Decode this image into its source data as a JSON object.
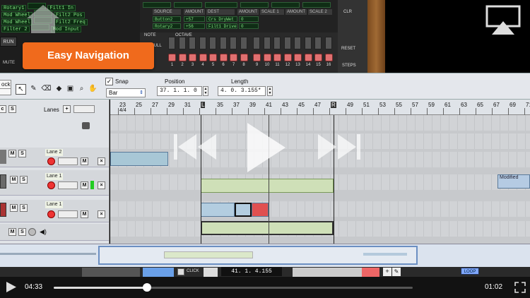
{
  "rack": {
    "lcd_rows": [
      [
        "Rotary1",
        "",
        "Filt1 In"
      ],
      [
        "Mod Wheel",
        "",
        "Filt2 Pos"
      ],
      [
        "Mod Wheel",
        "",
        "Filt2 Freq"
      ],
      [
        "Filter 2",
        "",
        "Mod Input"
      ]
    ],
    "matrix_headers": [
      "SOURCE",
      "AMOUNT",
      "DEST",
      "AMOUNT",
      "SCALE 1",
      "AMOUNT",
      "SCALE 2"
    ],
    "matrix_values": {
      "col_source": [
        "Button2",
        "Rotary2"
      ],
      "col_amount": [
        "",
        "+57",
        "+56"
      ],
      "col_dest": [
        "",
        "Crs DryWet",
        "Filt1 Drive"
      ],
      "col_amount2": [
        "0",
        "0",
        "0"
      ]
    },
    "run_label": "RUN",
    "mute_label": "MUTE",
    "full_label": "FULL",
    "clr_label": "CLR",
    "reset_label": "RESET",
    "steps_label": "STEPS",
    "note_label": "NOTE",
    "octave_label": "OCTAVE",
    "step_numbers": [
      "1",
      "2",
      "3",
      "4",
      "5",
      "6",
      "7",
      "8",
      "9",
      "10",
      "11",
      "12",
      "13",
      "14",
      "15",
      "16"
    ],
    "brand_color": "#f06a1c",
    "lcd_color": "#7fe07f"
  },
  "banner": {
    "label": "Easy Navigation"
  },
  "toolbar": {
    "block_label": "ock",
    "snap_label": "Snap",
    "snap_checked": true,
    "snap_value": "Bar",
    "position_label": "Position",
    "position_value": "37.  1.  1.     0",
    "length_label": "Length",
    "length_value": "4.  0.  3.155*",
    "tools": [
      "arrow-tool",
      "pencil-tool",
      "eraser-tool",
      "line-tool",
      "razor-tool",
      "magnify-tool",
      "hand-tool"
    ]
  },
  "lanes_header": {
    "label": "Lanes"
  },
  "tracks": [
    {
      "lane_label": "Lane 2",
      "mute": "M",
      "solo": "S"
    },
    {
      "lane_label": "Lane 1",
      "mute": "M",
      "solo": "S"
    },
    {
      "lane_label": "Lane 1",
      "mute": "M",
      "solo": "S"
    },
    {
      "lane_label": "",
      "mute": "M",
      "solo": "S"
    }
  ],
  "ruler": {
    "time_signature": "4/4",
    "bars": [
      "23",
      "25",
      "27",
      "29",
      "31",
      "L",
      "35",
      "37",
      "39",
      "41",
      "43",
      "45",
      "47",
      "R",
      "49",
      "51",
      "53",
      "55",
      "57",
      "59",
      "61",
      "63",
      "65",
      "67",
      "69",
      "71"
    ]
  },
  "clips": {
    "modified_label": "Modified"
  },
  "transport": {
    "click_label": "CLICK",
    "time_value": "41.  1.  4.155",
    "loop_label": "LOOP"
  },
  "player": {
    "current_time": "04:33",
    "duration": "01:02",
    "progress": 0.26
  }
}
